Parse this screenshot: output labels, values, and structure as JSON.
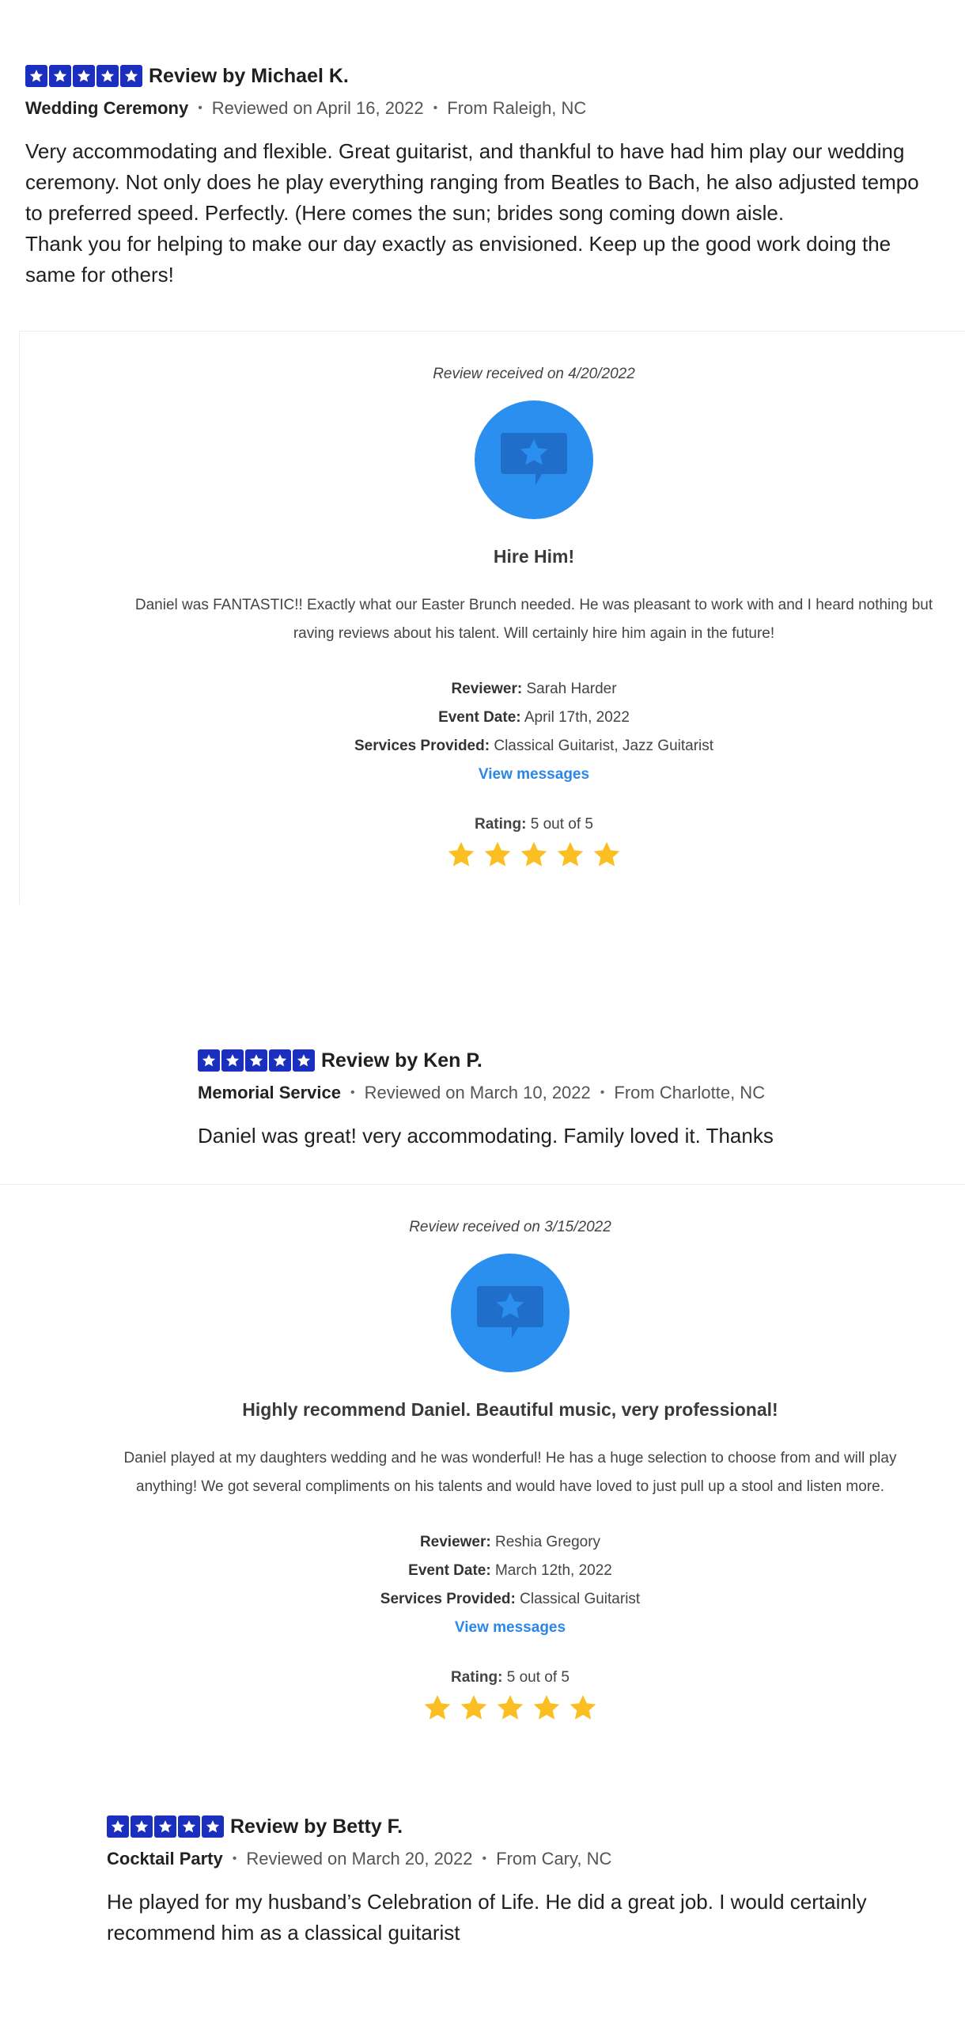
{
  "colors": {
    "review_star_bg": "#1b2fbf",
    "badge_bg": "#2b8ff0",
    "badge_icon": "#1f6ec9",
    "gold_star": "#fbbf24",
    "link": "#2b86e6"
  },
  "reviews": [
    {
      "title": "Review by Michael K.",
      "category": "Wedding Ceremony",
      "reviewed_on": "Reviewed on April 16, 2022",
      "from": "From Raleigh, NC",
      "body_lines": [
        "Very accommodating and flexible. Great guitarist, and thankful to have had him play our wedding ceremony. Not only does he play everything ranging from Beatles to Bach, he also adjusted tempo to preferred speed. Perfectly. (Here comes the sun; brides song coming down aisle.",
        "Thank you for helping to make our day exactly as envisioned. Keep up the good work doing the same for others!"
      ]
    },
    {
      "title": "Review by Ken P.",
      "category": "Memorial Service",
      "reviewed_on": "Reviewed on March 10, 2022",
      "from": "From Charlotte, NC",
      "body_lines": [
        "Daniel was great! very accommodating. Family loved it. Thanks"
      ]
    },
    {
      "title": "Review by Betty F.",
      "category": "Cocktail Party",
      "reviewed_on": "Reviewed on March 20, 2022",
      "from": "From Cary, NC",
      "body_lines": [
        "He played for my husband’s Celebration of Life. He did a great job. I would certainly recommend him as a classical guitarist"
      ]
    }
  ],
  "panels": [
    {
      "received": "Review received on 4/20/2022",
      "icon": "review-star-bubble-icon",
      "title": "Hire Him!",
      "text": "Daniel was FANTASTIC!! Exactly what our Easter Brunch needed. He was pleasant to work with and I heard nothing but raving reviews about his talent. Will certainly hire him again in the future!",
      "reviewer_label": "Reviewer:",
      "reviewer": "Sarah Harder",
      "event_label": "Event Date:",
      "event_date": "April 17th, 2022",
      "services_label": "Services Provided:",
      "services": "Classical Guitarist, Jazz Guitarist",
      "link": "View messages",
      "rating_label": "Rating:",
      "rating_text": "5 out of 5",
      "rating": 5
    },
    {
      "received": "Review received on 3/15/2022",
      "icon": "review-star-bubble-icon",
      "title": "Highly recommend Daniel. Beautiful music, very professional!",
      "text": "Daniel played at my daughters wedding and he was wonderful! He has a huge selection to choose from and will play anything! We got several compliments on his talents and would have loved to just pull up a stool and listen more.",
      "reviewer_label": "Reviewer:",
      "reviewer": "Reshia Gregory",
      "event_label": "Event Date:",
      "event_date": "March 12th, 2022",
      "services_label": "Services Provided:",
      "services": "Classical Guitarist",
      "link": "View messages",
      "rating_label": "Rating:",
      "rating_text": "5 out of 5",
      "rating": 5
    }
  ]
}
